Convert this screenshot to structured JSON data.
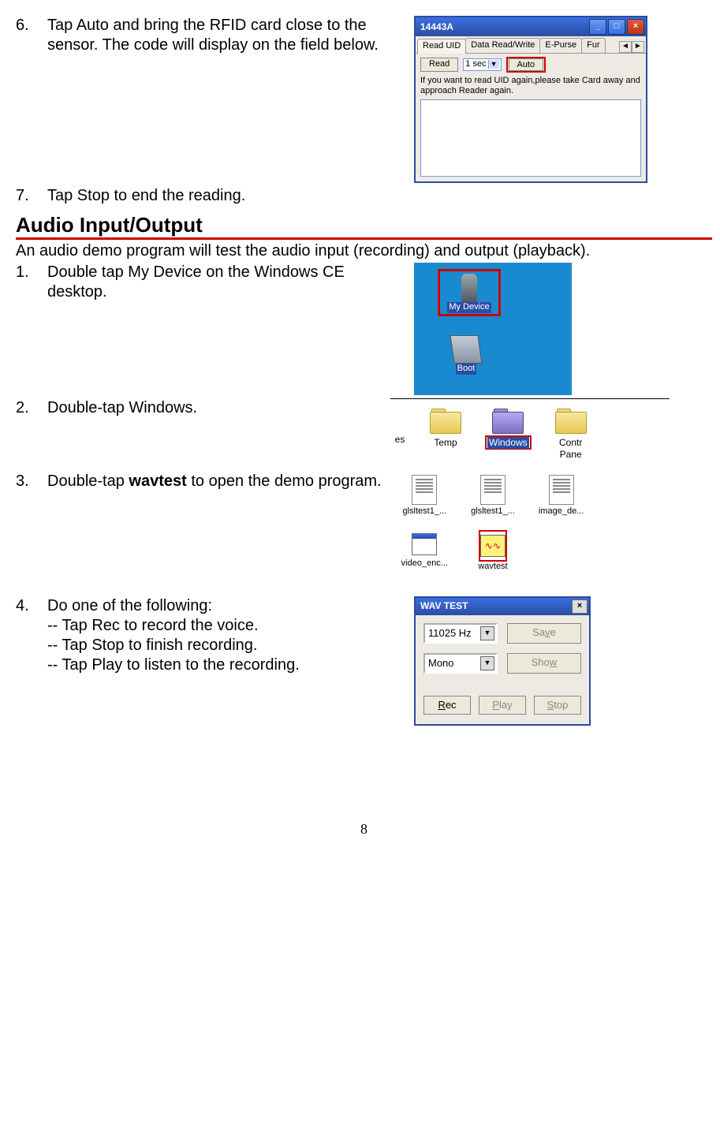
{
  "step6": {
    "num": "6.",
    "text": "Tap Auto and bring the RFID card close to the sensor. The code will display on the field below."
  },
  "fig_rfid": {
    "title": "14443A",
    "tabs": {
      "t1": "Read UID",
      "t2": "Data Read/Write",
      "t3": "E-Purse",
      "t4": "Fur"
    },
    "read_btn": "Read",
    "interval": "1  sec",
    "auto_btn": "Auto",
    "note": "If you want to read UID again,please take Card away and approach Reader again."
  },
  "step7": {
    "num": "7.",
    "text": "Tap Stop to end the reading."
  },
  "heading": "Audio Input/Output",
  "intro": "An audio demo program will test the audio input (recording) and output (playback).",
  "step1": {
    "num": "1.",
    "text": "Double tap My Device on the Windows CE desktop."
  },
  "fig_desktop": {
    "label1": "My Device",
    "label2": "Boot"
  },
  "step2": {
    "num": "2.",
    "text": "Double-tap Windows."
  },
  "fig_explorer": {
    "c0": "es",
    "c1": "Temp",
    "c2": "Windows",
    "c3p1": "Contr",
    "c3p2": "Pane"
  },
  "step3": {
    "num": "3.",
    "text_a": "Double-tap ",
    "text_b": "wavtest",
    "text_c": " to open the demo program."
  },
  "fig_files": {
    "f1": "glsltest1_...",
    "f2": "glsltest1_...",
    "f3": "image_de...",
    "f4": "video_enc...",
    "f5": "wavtest"
  },
  "step4": {
    "num": "4.",
    "l1": "Do one of the following:",
    "l2": "-- Tap Rec to record the voice.",
    "l3": "-- Tap Stop to finish recording.",
    "l4": "-- Tap Play to listen to the recording."
  },
  "fig_wav": {
    "title": "WAV TEST",
    "hz": "11025 Hz",
    "ch": "Mono",
    "save_a": "Sa",
    "save_b": "v",
    "save_c": "e",
    "show_a": "Sho",
    "show_b": "w",
    "rec_a": "R",
    "rec_b": "ec",
    "play_a": "P",
    "play_b": "lay",
    "stop_a": "S",
    "stop_b": "top"
  },
  "pagenum": "8"
}
